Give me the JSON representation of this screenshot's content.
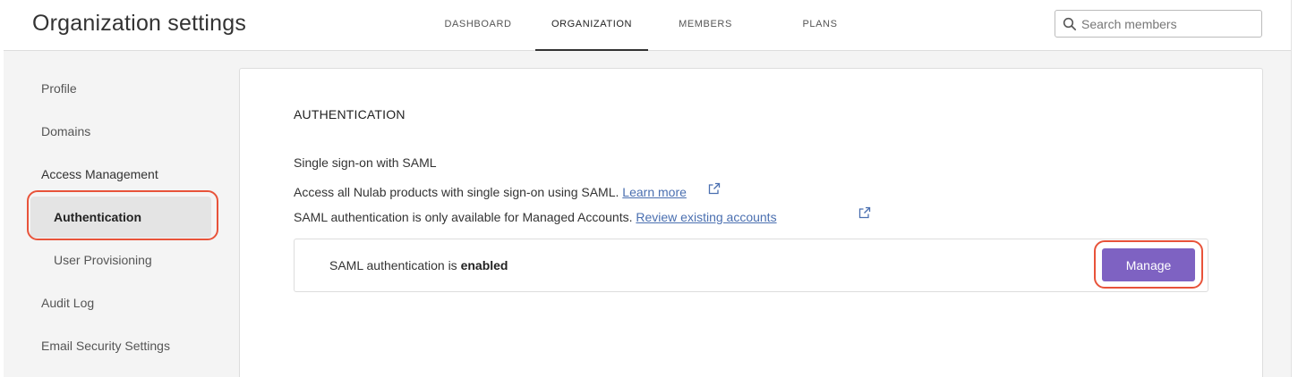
{
  "header": {
    "title": "Organization settings",
    "tabs": [
      {
        "label": "DASHBOARD"
      },
      {
        "label": "ORGANIZATION"
      },
      {
        "label": "MEMBERS"
      },
      {
        "label": "PLANS"
      }
    ],
    "active_tab": "ORGANIZATION",
    "search": {
      "placeholder": "Search members",
      "value": ""
    }
  },
  "sidebar": {
    "items": [
      {
        "label": "Profile"
      },
      {
        "label": "Domains"
      },
      {
        "label": "Access Management"
      },
      {
        "label": "Authentication"
      },
      {
        "label": "User Provisioning"
      },
      {
        "label": "Audit Log"
      },
      {
        "label": "Email Security Settings"
      }
    ],
    "active_item": "Authentication"
  },
  "main": {
    "section_title": "AUTHENTICATION",
    "subsection_title": "Single sign-on with SAML",
    "line1_text": "Access all Nulab products with single sign-on using SAML.",
    "line1_link": "Learn more",
    "line2_text": "SAML authentication is only available for Managed Accounts.",
    "line2_link": "Review existing accounts",
    "status_prefix": "SAML authentication is",
    "status_value": "enabled",
    "manage_label": "Manage"
  },
  "colors": {
    "accent": "#7e62c2",
    "link": "#4a6fb0",
    "highlight": "#e8533a"
  },
  "icons": [
    "search-icon",
    "external-link-icon"
  ]
}
